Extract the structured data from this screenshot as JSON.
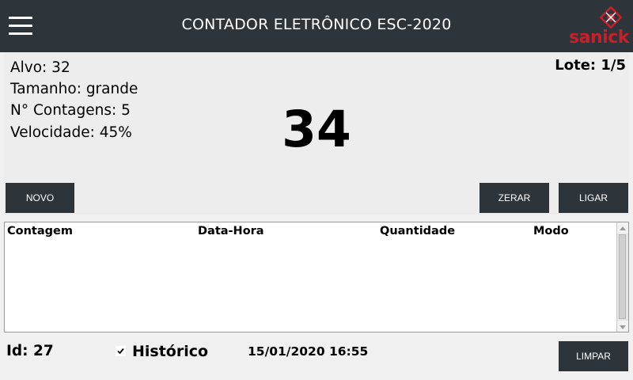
{
  "header": {
    "title": "CONTADOR ELETRÔNICO ESC-2020",
    "menu_icon": "hamburger-menu-icon",
    "logo_text": "sanick"
  },
  "info": {
    "alvo": "Alvo: 32",
    "tamanho": "Tamanho: grande",
    "contagens": "N° Contagens: 5",
    "velocidade": "Velocidade: 45%",
    "lote": "Lote: 1/5",
    "count_value": "34"
  },
  "buttons": {
    "novo": "NOVO",
    "zerar": "ZERAR",
    "ligar": "LIGAR",
    "limpar": "LIMPAR"
  },
  "table": {
    "columns": [
      "Contagem",
      "Data-Hora",
      "Quantidade",
      "Modo"
    ],
    "rows": []
  },
  "footer": {
    "id": "Id: 27",
    "historico_label": "Histórico",
    "historico_checked": true,
    "datetime": "15/01/2020 16:55"
  },
  "colors": {
    "header_bg": "#2d343a",
    "button_bg": "#2d343a",
    "logo_red": "#c8202a",
    "panel_bg": "#ededed"
  }
}
